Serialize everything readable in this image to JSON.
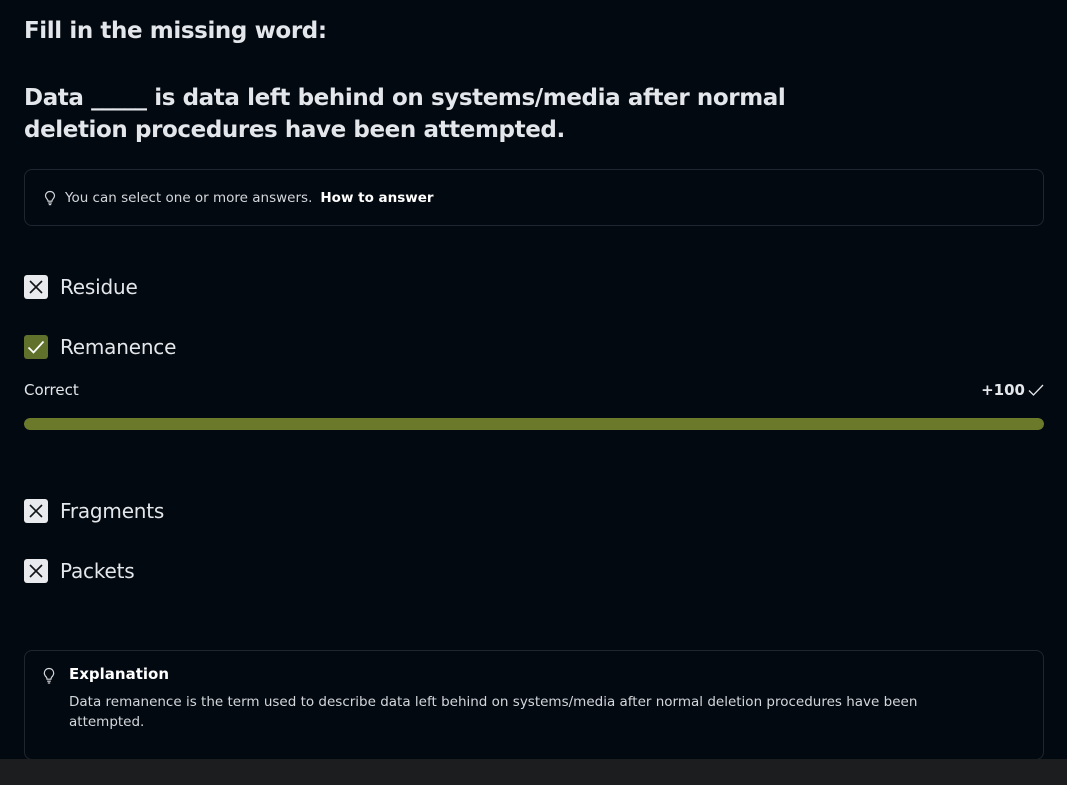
{
  "question": {
    "instruction": "Fill in the missing word:",
    "text": "Data _____ is data left behind on systems/media after normal deletion procedures have been attempted."
  },
  "hint": {
    "icon": "lightbulb-icon",
    "text": "You can select one or more answers.",
    "link_label": "How to answer"
  },
  "options": [
    {
      "label": "Residue",
      "state": "incorrect"
    },
    {
      "label": "Remanence",
      "state": "correct"
    },
    {
      "label": "Fragments",
      "state": "incorrect"
    },
    {
      "label": "Packets",
      "state": "incorrect"
    }
  ],
  "result": {
    "status": "Correct",
    "score": "+100",
    "progress_percent": 100
  },
  "explanation": {
    "title": "Explanation",
    "text": "Data remanence is the term used to describe data left behind on systems/media after normal deletion procedures have been attempted."
  },
  "colors": {
    "background": "#030910",
    "accent_correct": "#5f712a",
    "progress_fill": "#6b7a2a",
    "incorrect_box": "#e8eaed"
  }
}
